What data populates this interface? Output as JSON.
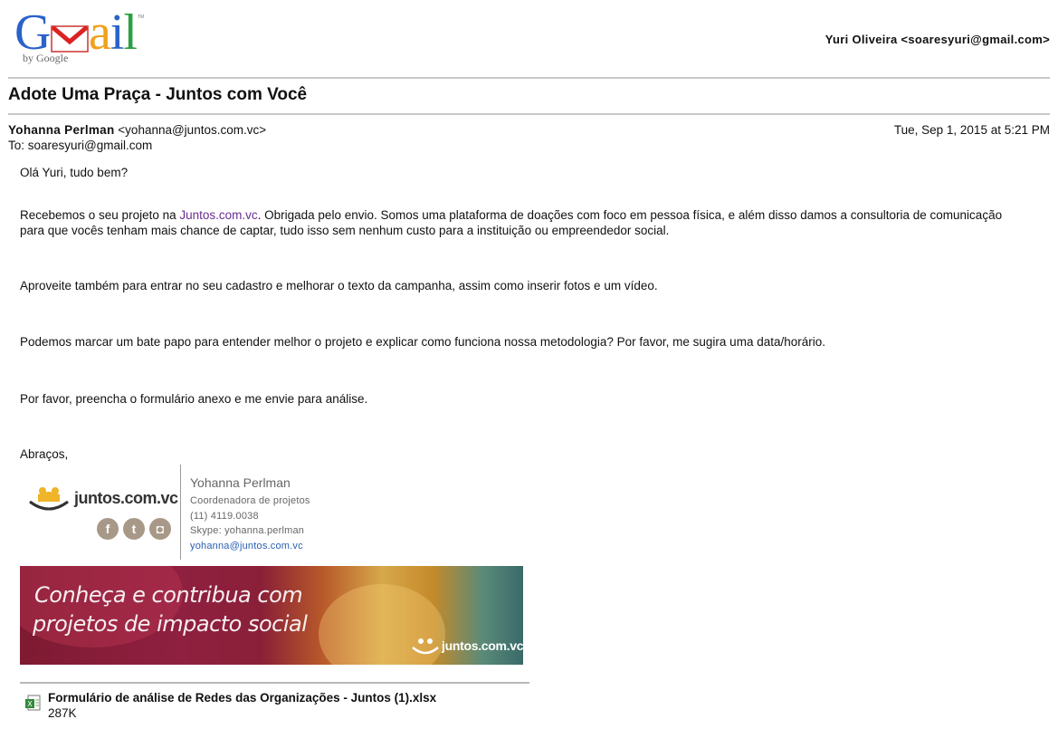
{
  "logo": {
    "brand": "Gmail",
    "byline": "by Google"
  },
  "account": "Yuri Oliveira <soaresyuri@gmail.com>",
  "subject": "Adote Uma Praça - Juntos com Você",
  "message": {
    "from_name": "Yohanna Perlman",
    "from_email": "<yohanna@juntos.com.vc>",
    "to": "To: soaresyuri@gmail.com",
    "date": "Tue, Sep 1, 2015 at 5:21 PM"
  },
  "body": {
    "greeting": "Olá Yuri, tudo bem?",
    "p1_before": "Recebemos o seu projeto na ",
    "p1_link": "Juntos.com.vc",
    "p1_after": ". Obrigada pelo envio. Somos uma plataforma de doações com foco em pessoa física, e além disso damos a consultoria de comunicação para que vocês tenham mais chance de captar, tudo isso sem nenhum custo para a instituição ou empreendedor social.",
    "p2": "Aproveite também para entrar no seu cadastro e melhorar o texto da campanha, assim como inserir fotos e um vídeo.",
    "p3": "Podemos marcar um bate papo para entender melhor o projeto e explicar como funciona nossa metodologia? Por favor, me sugira uma data/horário.",
    "p4": "Por favor, preencha o formulário anexo e me envie para análise.",
    "closing": "Abraços,"
  },
  "signature": {
    "logo_text": "juntos.com.vc",
    "name": "Yohanna Perlman",
    "role": "Coordenadora de projetos",
    "phone": "(11) 4119.0038",
    "skype": "Skype: yohanna.perlman",
    "email": "yohanna@juntos.com.vc",
    "social_icons": [
      "facebook-icon",
      "twitter-icon",
      "instagram-icon"
    ]
  },
  "banner": {
    "line1": "Conheça e contribua com",
    "line2": "projetos de impacto social",
    "logo_text": "juntos.com.vc"
  },
  "attachment": {
    "filename": "Formulário de análise de Redes das Organizações - Juntos (1).xlsx",
    "size": "287K",
    "icon": "excel-file-icon"
  },
  "colors": {
    "link": "#6b2c91",
    "sig_link": "#2a5fb0",
    "divider": "#c8c8c8"
  }
}
